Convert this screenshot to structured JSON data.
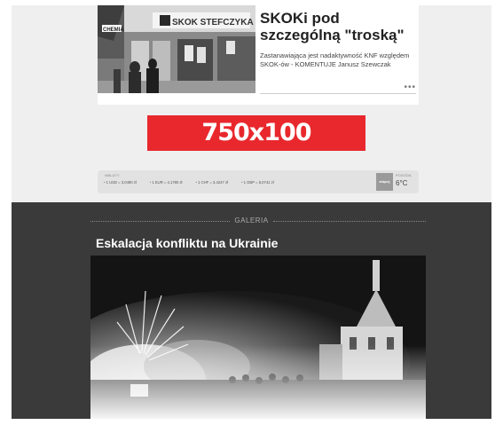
{
  "article": {
    "title": "SKOKi pod szczególną \"troską\"",
    "lead": "Zastanawiająca jest nadaktywność KNF względem SKOK-ów - KOMENTUJE Janusz Szewczak",
    "more": "•••",
    "image_sign": "SKOK STEFCZYKA",
    "image_sign2": "CHEMIA"
  },
  "ad": {
    "label": "750x100"
  },
  "ticker": {
    "label": "WALUTY",
    "rates": [
      "1 USD = 3,0490 zł",
      "1 EUR = 4,1780 zł",
      "1 CHF = 3,4247 zł",
      "1 GBP = 5,0741 zł"
    ],
    "weather_button": "więcej",
    "weather_label": "POGODA",
    "temperature": "6°C"
  },
  "gallery": {
    "label": "GALERIA",
    "title": "Eskalacja konfliktu na Ukrainie"
  }
}
